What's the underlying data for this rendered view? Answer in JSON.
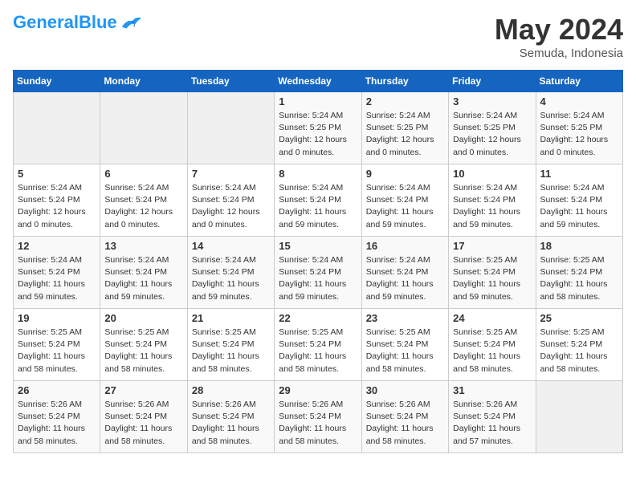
{
  "header": {
    "logo_general": "General",
    "logo_blue": "Blue",
    "month": "May 2024",
    "location": "Semuda, Indonesia"
  },
  "weekdays": [
    "Sunday",
    "Monday",
    "Tuesday",
    "Wednesday",
    "Thursday",
    "Friday",
    "Saturday"
  ],
  "weeks": [
    [
      {
        "day": "",
        "info": ""
      },
      {
        "day": "",
        "info": ""
      },
      {
        "day": "",
        "info": ""
      },
      {
        "day": "1",
        "info": "Sunrise: 5:24 AM\nSunset: 5:25 PM\nDaylight: 12 hours\nand 0 minutes."
      },
      {
        "day": "2",
        "info": "Sunrise: 5:24 AM\nSunset: 5:25 PM\nDaylight: 12 hours\nand 0 minutes."
      },
      {
        "day": "3",
        "info": "Sunrise: 5:24 AM\nSunset: 5:25 PM\nDaylight: 12 hours\nand 0 minutes."
      },
      {
        "day": "4",
        "info": "Sunrise: 5:24 AM\nSunset: 5:25 PM\nDaylight: 12 hours\nand 0 minutes."
      }
    ],
    [
      {
        "day": "5",
        "info": "Sunrise: 5:24 AM\nSunset: 5:24 PM\nDaylight: 12 hours\nand 0 minutes."
      },
      {
        "day": "6",
        "info": "Sunrise: 5:24 AM\nSunset: 5:24 PM\nDaylight: 12 hours\nand 0 minutes."
      },
      {
        "day": "7",
        "info": "Sunrise: 5:24 AM\nSunset: 5:24 PM\nDaylight: 12 hours\nand 0 minutes."
      },
      {
        "day": "8",
        "info": "Sunrise: 5:24 AM\nSunset: 5:24 PM\nDaylight: 11 hours\nand 59 minutes."
      },
      {
        "day": "9",
        "info": "Sunrise: 5:24 AM\nSunset: 5:24 PM\nDaylight: 11 hours\nand 59 minutes."
      },
      {
        "day": "10",
        "info": "Sunrise: 5:24 AM\nSunset: 5:24 PM\nDaylight: 11 hours\nand 59 minutes."
      },
      {
        "day": "11",
        "info": "Sunrise: 5:24 AM\nSunset: 5:24 PM\nDaylight: 11 hours\nand 59 minutes."
      }
    ],
    [
      {
        "day": "12",
        "info": "Sunrise: 5:24 AM\nSunset: 5:24 PM\nDaylight: 11 hours\nand 59 minutes."
      },
      {
        "day": "13",
        "info": "Sunrise: 5:24 AM\nSunset: 5:24 PM\nDaylight: 11 hours\nand 59 minutes."
      },
      {
        "day": "14",
        "info": "Sunrise: 5:24 AM\nSunset: 5:24 PM\nDaylight: 11 hours\nand 59 minutes."
      },
      {
        "day": "15",
        "info": "Sunrise: 5:24 AM\nSunset: 5:24 PM\nDaylight: 11 hours\nand 59 minutes."
      },
      {
        "day": "16",
        "info": "Sunrise: 5:24 AM\nSunset: 5:24 PM\nDaylight: 11 hours\nand 59 minutes."
      },
      {
        "day": "17",
        "info": "Sunrise: 5:25 AM\nSunset: 5:24 PM\nDaylight: 11 hours\nand 59 minutes."
      },
      {
        "day": "18",
        "info": "Sunrise: 5:25 AM\nSunset: 5:24 PM\nDaylight: 11 hours\nand 58 minutes."
      }
    ],
    [
      {
        "day": "19",
        "info": "Sunrise: 5:25 AM\nSunset: 5:24 PM\nDaylight: 11 hours\nand 58 minutes."
      },
      {
        "day": "20",
        "info": "Sunrise: 5:25 AM\nSunset: 5:24 PM\nDaylight: 11 hours\nand 58 minutes."
      },
      {
        "day": "21",
        "info": "Sunrise: 5:25 AM\nSunset: 5:24 PM\nDaylight: 11 hours\nand 58 minutes."
      },
      {
        "day": "22",
        "info": "Sunrise: 5:25 AM\nSunset: 5:24 PM\nDaylight: 11 hours\nand 58 minutes."
      },
      {
        "day": "23",
        "info": "Sunrise: 5:25 AM\nSunset: 5:24 PM\nDaylight: 11 hours\nand 58 minutes."
      },
      {
        "day": "24",
        "info": "Sunrise: 5:25 AM\nSunset: 5:24 PM\nDaylight: 11 hours\nand 58 minutes."
      },
      {
        "day": "25",
        "info": "Sunrise: 5:25 AM\nSunset: 5:24 PM\nDaylight: 11 hours\nand 58 minutes."
      }
    ],
    [
      {
        "day": "26",
        "info": "Sunrise: 5:26 AM\nSunset: 5:24 PM\nDaylight: 11 hours\nand 58 minutes."
      },
      {
        "day": "27",
        "info": "Sunrise: 5:26 AM\nSunset: 5:24 PM\nDaylight: 11 hours\nand 58 minutes."
      },
      {
        "day": "28",
        "info": "Sunrise: 5:26 AM\nSunset: 5:24 PM\nDaylight: 11 hours\nand 58 minutes."
      },
      {
        "day": "29",
        "info": "Sunrise: 5:26 AM\nSunset: 5:24 PM\nDaylight: 11 hours\nand 58 minutes."
      },
      {
        "day": "30",
        "info": "Sunrise: 5:26 AM\nSunset: 5:24 PM\nDaylight: 11 hours\nand 58 minutes."
      },
      {
        "day": "31",
        "info": "Sunrise: 5:26 AM\nSunset: 5:24 PM\nDaylight: 11 hours\nand 57 minutes."
      },
      {
        "day": "",
        "info": ""
      }
    ]
  ]
}
